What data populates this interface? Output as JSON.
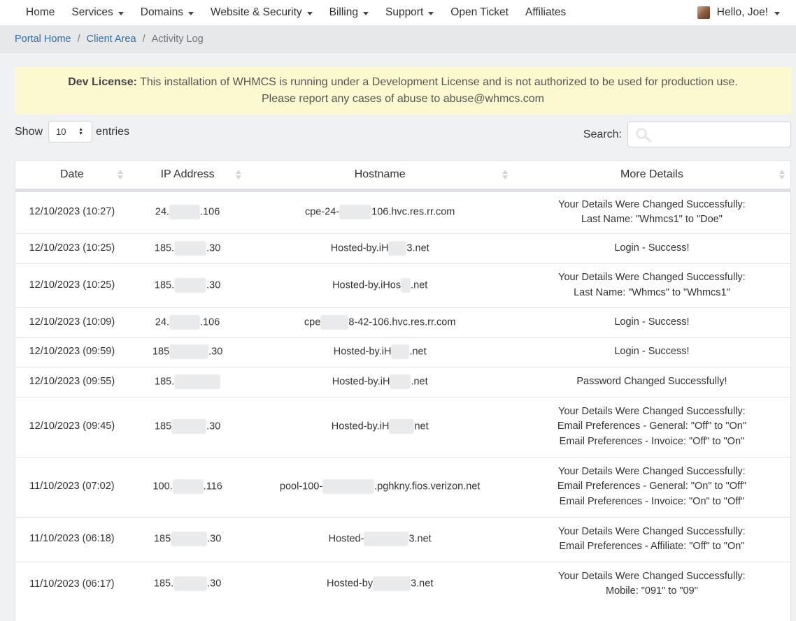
{
  "nav": {
    "items": [
      {
        "label": "Home",
        "dropdown": false
      },
      {
        "label": "Services",
        "dropdown": true
      },
      {
        "label": "Domains",
        "dropdown": true
      },
      {
        "label": "Website & Security",
        "dropdown": true
      },
      {
        "label": "Billing",
        "dropdown": true
      },
      {
        "label": "Support",
        "dropdown": true
      },
      {
        "label": "Open Ticket",
        "dropdown": false
      },
      {
        "label": "Affiliates",
        "dropdown": false
      }
    ],
    "user_greeting": "Hello, Joe!"
  },
  "breadcrumb": {
    "home": "Portal Home",
    "client_area": "Client Area",
    "current": "Activity Log",
    "separator": "/"
  },
  "alert": {
    "title": "Dev License:",
    "line1": "This installation of WHMCS is running under a Development License and is not authorized to be used for production use.",
    "line2": "Please report any cases of abuse to abuse@whmcs.com"
  },
  "controls": {
    "show_label": "Show",
    "entries_value": "10",
    "entries_label": "entries",
    "search_label": "Search:",
    "search_value": ""
  },
  "table": {
    "columns": [
      "Date",
      "IP Address",
      "Hostname",
      "More Details"
    ],
    "rows": [
      {
        "height": 62,
        "date": "12/10/2023 (10:27)",
        "ip": [
          [
            "24.",
            0
          ],
          [
            "",
            44
          ],
          [
            ".106",
            0
          ]
        ],
        "host": [
          [
            "cpe-24-",
            0
          ],
          [
            "",
            46
          ],
          [
            "106.hvc.res.rr.com",
            0
          ]
        ],
        "details": [
          "Your Details Were Changed Successfully:",
          "Last Name: \"Whmcs1\" to \"Doe\""
        ]
      },
      {
        "height": 43,
        "date": "12/10/2023 (10:25)",
        "ip": [
          [
            "185.",
            0
          ],
          [
            "",
            46
          ],
          [
            ".30",
            0
          ]
        ],
        "host": [
          [
            "Hosted-by.iH",
            0
          ],
          [
            "",
            26
          ],
          [
            "3.net",
            0
          ]
        ],
        "details": [
          "Login - Success!"
        ]
      },
      {
        "height": 63,
        "date": "12/10/2023 (10:25)",
        "ip": [
          [
            "185.",
            0
          ],
          [
            "",
            46
          ],
          [
            ".30",
            0
          ]
        ],
        "host": [
          [
            "Hosted-by.iHos",
            0
          ],
          [
            "",
            14
          ],
          [
            ".net",
            0
          ]
        ],
        "details": [
          "Your Details Were Changed Successfully:",
          "Last Name: \"Whmcs\" to \"Whmcs1\""
        ]
      },
      {
        "height": 43,
        "date": "12/10/2023 (10:09)",
        "ip": [
          [
            "24.",
            0
          ],
          [
            "",
            44
          ],
          [
            ".106",
            0
          ]
        ],
        "host": [
          [
            "cpe",
            0
          ],
          [
            "",
            40
          ],
          [
            "8-42-106.hvc.res.rr.com",
            0
          ]
        ],
        "details": [
          "Login - Success!"
        ]
      },
      {
        "height": 42,
        "date": "12/10/2023 (09:59)",
        "ip": [
          [
            "185",
            0
          ],
          [
            "",
            56
          ],
          [
            ".30",
            0
          ]
        ],
        "host": [
          [
            "Hosted-by.iH",
            0
          ],
          [
            "",
            26
          ],
          [
            ".net",
            0
          ]
        ],
        "details": [
          "Login - Success!"
        ]
      },
      {
        "height": 43,
        "date": "12/10/2023 (09:55)",
        "ip": [
          [
            "185.",
            0
          ],
          [
            "",
            66
          ],
          [
            "",
            0
          ]
        ],
        "host": [
          [
            "Hosted-by.iH",
            0
          ],
          [
            "",
            30
          ],
          [
            ".net",
            0
          ]
        ],
        "details": [
          "Password Changed Successfully!"
        ]
      },
      {
        "height": 86,
        "date": "12/10/2023 (09:45)",
        "ip": [
          [
            "185",
            0
          ],
          [
            "",
            50
          ],
          [
            ".30",
            0
          ]
        ],
        "host": [
          [
            "Hosted-by.iH",
            0
          ],
          [
            "",
            36
          ],
          [
            "net",
            0
          ]
        ],
        "details": [
          "Your Details Were Changed Successfully:",
          "Email Preferences - General: \"Off\" to \"On\"",
          "Email Preferences - Invoice: \"Off\" to \"On\""
        ]
      },
      {
        "height": 86,
        "date": "11/10/2023 (07:02)",
        "ip": [
          [
            "100.",
            0
          ],
          [
            "",
            44
          ],
          [
            ".116",
            0
          ]
        ],
        "host": [
          [
            "pool-100-",
            0
          ],
          [
            "",
            74
          ],
          [
            ".pghkny.fios.verizon.net",
            0
          ]
        ],
        "details": [
          "Your Details Were Changed Successfully:",
          "Email Preferences - General: \"On\" to \"Off\"",
          "Email Preferences - Invoice: \"On\" to \"Off\""
        ]
      },
      {
        "height": 64,
        "date": "11/10/2023 (06:18)",
        "ip": [
          [
            "185",
            0
          ],
          [
            "",
            52
          ],
          [
            ".30",
            0
          ]
        ],
        "host": [
          [
            "Hosted-",
            0
          ],
          [
            "",
            64
          ],
          [
            "3.net",
            0
          ]
        ],
        "details": [
          "Your Details Were Changed Successfully:",
          "Email Preferences - Affiliate: \"Off\" to \"On\""
        ]
      },
      {
        "height": 64,
        "date": "11/10/2023 (06:17)",
        "ip": [
          [
            "185.",
            0
          ],
          [
            "",
            48
          ],
          [
            ".30",
            0
          ]
        ],
        "host": [
          [
            "Hosted-by",
            0
          ],
          [
            "",
            54
          ],
          [
            "3.net",
            0
          ]
        ],
        "details": [
          "Your Details Were Changed Successfully:",
          "Mobile: \"091\" to \"09\""
        ]
      }
    ]
  }
}
